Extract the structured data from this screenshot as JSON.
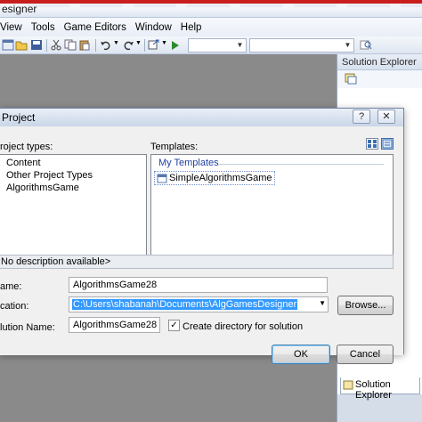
{
  "window": {
    "title": "esigner"
  },
  "menubar": {
    "items": [
      "View",
      "Tools",
      "Game Editors",
      "Window",
      "Help"
    ]
  },
  "solution_explorer": {
    "title": "Solution Explorer",
    "tab_label": "Solution Explorer"
  },
  "dialog": {
    "title": "Project",
    "help_label": "?",
    "close_label": "✕",
    "project_types_label": "roject types:",
    "project_types": [
      "Content",
      "Other Project Types",
      "AlgorithmsGame"
    ],
    "templates_label": "Templates:",
    "templates_group": "My Templates",
    "templates": [
      "SimpleAlgorithmsGame"
    ],
    "description": "No description available>",
    "name_label": "ame:",
    "name_value": "AlgorithmsGame28",
    "location_label": "cation:",
    "location_value": "C:\\Users\\shabanah\\Documents\\AlgGamesDesigner",
    "browse_label": "Browse...",
    "solution_name_label": "lution Name:",
    "solution_name_value": "AlgorithmsGame28",
    "create_dir_label": "Create directory for solution",
    "create_dir_checked": true,
    "ok_label": "OK",
    "cancel_label": "Cancel"
  },
  "colors": {
    "accent": "#3399ff",
    "workspace": "#8a8a8a"
  }
}
